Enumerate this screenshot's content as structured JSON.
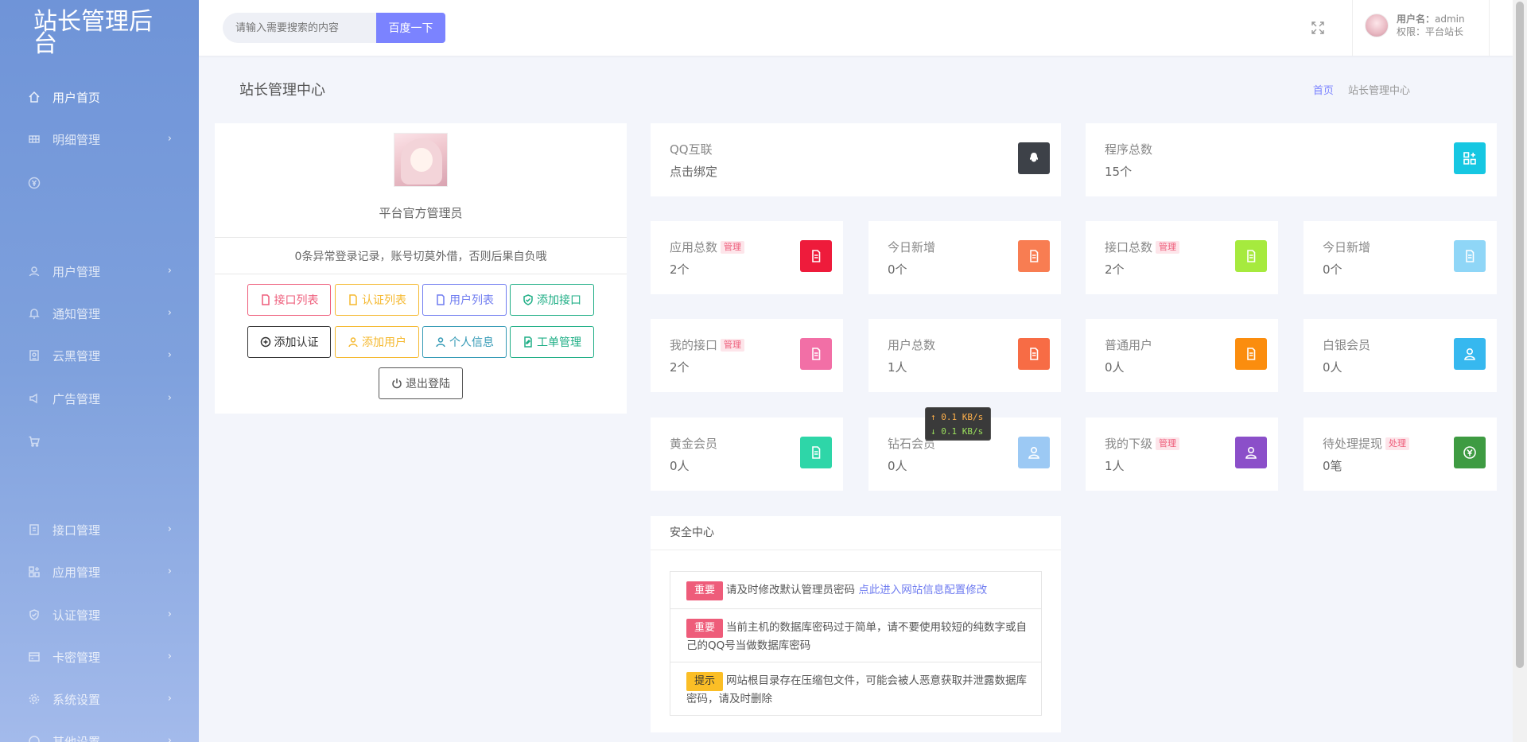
{
  "sidebar": {
    "brand": "站长管理后台",
    "items": [
      {
        "label": "用户首页",
        "icon": "home-icon",
        "has_chevron": false
      },
      {
        "label": "明细管理",
        "icon": "list-icon",
        "has_chevron": true
      },
      {
        "label": "",
        "icon": "yen-icon",
        "has_chevron": false
      },
      {
        "label": "用户管理",
        "icon": "user-icon",
        "has_chevron": true
      },
      {
        "label": "通知管理",
        "icon": "bell-icon",
        "has_chevron": true
      },
      {
        "label": "云黑管理",
        "icon": "id-card-icon",
        "has_chevron": true
      },
      {
        "label": "广告管理",
        "icon": "megaphone-icon",
        "has_chevron": true
      },
      {
        "label": "",
        "icon": "cart-icon",
        "has_chevron": false
      },
      {
        "label": "接口管理",
        "icon": "api-icon",
        "has_chevron": true
      },
      {
        "label": "应用管理",
        "icon": "apps-icon",
        "has_chevron": true
      },
      {
        "label": "认证管理",
        "icon": "shield-icon",
        "has_chevron": true
      },
      {
        "label": "卡密管理",
        "icon": "card-icon",
        "has_chevron": true
      },
      {
        "label": "系统设置",
        "icon": "gear-icon",
        "has_chevron": true
      },
      {
        "label": "其他设置",
        "icon": "more-icon",
        "has_chevron": true
      }
    ]
  },
  "header": {
    "search_placeholder": "请输入需要搜索的内容",
    "search_button": "百度一下",
    "username_label": "用户名：",
    "username": "admin",
    "role_label": "权限：",
    "role": "平台站长"
  },
  "page": {
    "title": "站长管理中心",
    "breadcrumb_home": "首页",
    "breadcrumb_current": "站长管理中心"
  },
  "profile": {
    "name": "平台官方管理员",
    "notice": "0条异常登录记录，账号切莫外借，否则后果自负哦",
    "buttons": {
      "api_list": "接口列表",
      "auth_list": "认证列表",
      "user_list": "用户列表",
      "add_api": "添加接口",
      "add_auth": "添加认证",
      "add_user": "添加用户",
      "personal_info": "个人信息",
      "ticket_manage": "工单管理",
      "logout": "退出登陆"
    }
  },
  "stats": {
    "qq": {
      "label": "QQ互联",
      "value": "点击绑定",
      "color": "#3d4148"
    },
    "programs": {
      "label": "程序总数",
      "value": "15个",
      "color": "#16c7e2"
    },
    "apps_total": {
      "label": "应用总数",
      "tag": "管理",
      "value": "2个",
      "color": "#ee1b3b"
    },
    "today_new_1": {
      "label": "今日新增",
      "value": "0个",
      "color": "#f87d52"
    },
    "api_total": {
      "label": "接口总数",
      "tag": "管理",
      "value": "2个",
      "color": "#a6ea3e"
    },
    "today_new_2": {
      "label": "今日新增",
      "value": "0个",
      "color": "#8fd6f7"
    },
    "my_api": {
      "label": "我的接口",
      "tag": "管理",
      "value": "2个",
      "color": "#f26fa6"
    },
    "user_total": {
      "label": "用户总数",
      "value": "1人",
      "color": "#f76c45"
    },
    "normal_users": {
      "label": "普通用户",
      "value": "0人",
      "color": "#fb8d0e"
    },
    "silver": {
      "label": "白银会员",
      "value": "0人",
      "color": "#36b8ef"
    },
    "gold": {
      "label": "黄金会员",
      "value": "0人",
      "color": "#2ed6a8"
    },
    "diamond": {
      "label": "钻石会员",
      "value": "0人",
      "color": "#9cc9f4"
    },
    "my_subordinates": {
      "label": "我的下级",
      "tag": "管理",
      "value": "1人",
      "color": "#8b4fc9"
    },
    "pending_withdraw": {
      "label": "待处理提现",
      "tag": "处理",
      "value": "0笔",
      "color": "#3e9b42"
    }
  },
  "security": {
    "title": "安全中心",
    "items": [
      {
        "badge": "重要",
        "text": "请及时修改默认管理员密码 ",
        "link": "点此进入网站信息配置修改"
      },
      {
        "badge": "重要",
        "text": "当前主机的数据库密码过于简单，请不要使用较短的纯数字或自己的QQ号当做数据库密码",
        "link": ""
      },
      {
        "badge": "提示",
        "text": "网站根目录存在压缩包文件，可能会被人恶意获取并泄露数据库密码，请及时删除",
        "link": ""
      }
    ]
  },
  "netspeed": {
    "up": "↑ 0.1 KB/s",
    "down": "↓ 0.1 KB/s"
  }
}
